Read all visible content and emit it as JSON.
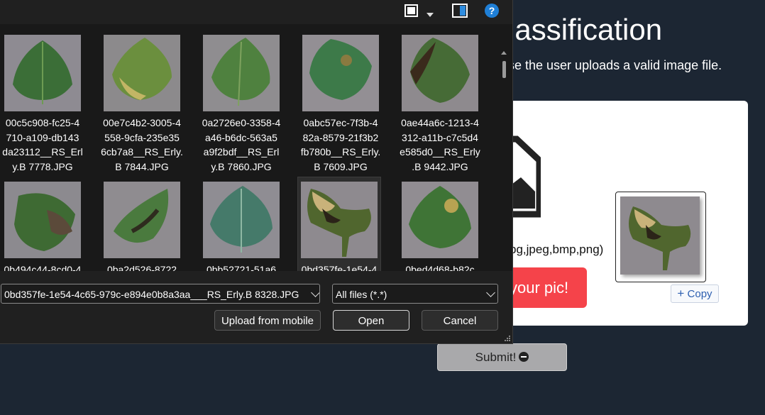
{
  "background": {
    "title": "lassification",
    "subtitle": "se the user uploads a valid image file.",
    "formats_text": "pg,jpeg,bmp,png)",
    "choose_button": "your pic!",
    "copy_button": "Copy",
    "copy_icon": "plus-icon",
    "submit_button": "Submit!",
    "submit_icon": "minus-circle-icon",
    "accent_color": "#f5434a",
    "page_bg": "#1c2633"
  },
  "dialog": {
    "toolbar": {
      "view_icon": "view-mode-icon",
      "view_menu_icon": "chevron-down-icon",
      "preview_pane_icon": "preview-pane-icon",
      "help_icon": "help-icon",
      "help_label": "?"
    },
    "files_row1": [
      {
        "name": "00c5c908-fc25-4710-a109-db143da23112___RS_Erly.B 7778.JPG",
        "lines": [
          "00c5c908-fc25-4",
          "710-a109-db143",
          "da23112__RS_Erl",
          "y.B 7778.JPG"
        ]
      },
      {
        "name": "00e7c4b2-3005-4558-9cfa-235e356cb7a8___RS_Erly.B 7844.JPG",
        "lines": [
          "00e7c4b2-3005-4",
          "558-9cfa-235e35",
          "6cb7a8__RS_Erly.",
          "B 7844.JPG"
        ]
      },
      {
        "name": "0a2726e0-3358-4a46-b6dc-563a5a9f2bdf___RS_Erly.B 7860.JPG",
        "lines": [
          "0a2726e0-3358-4",
          "a46-b6dc-563a5",
          "a9f2bdf__RS_Erl",
          "y.B 7860.JPG"
        ]
      },
      {
        "name": "0abc57ec-7f3b-482a-8579-21f3b2fb780b___RS_Erly.B 7609.JPG",
        "lines": [
          "0abc57ec-7f3b-4",
          "82a-8579-21f3b2",
          "fb780b__RS_Erly.",
          "B 7609.JPG"
        ]
      },
      {
        "name": "0ae44a6c-1213-4312-a11b-c7c5d4e585d0___RS_Erly.B 9442.JPG",
        "lines": [
          "0ae44a6c-1213-4",
          "312-a11b-c7c5d4",
          "e585d0__RS_Erly",
          ".B 9442.JPG"
        ]
      }
    ],
    "files_row2": [
      {
        "partial": "0b494c44-8cd0-4"
      },
      {
        "partial": "0ba2d526-8722"
      },
      {
        "partial": "0bb52721-51a6"
      },
      {
        "partial": "0bd357fe-1e54-4"
      },
      {
        "partial": "0bed4d68-b82c"
      }
    ],
    "filename_value": "0bd357fe-1e54-4c65-979c-e894e0b8a3aa___RS_Erly.B 8328.JPG",
    "filter_value": "All files (*.*)",
    "upload_mobile_button": "Upload from mobile",
    "open_button": "Open",
    "cancel_button": "Cancel"
  }
}
